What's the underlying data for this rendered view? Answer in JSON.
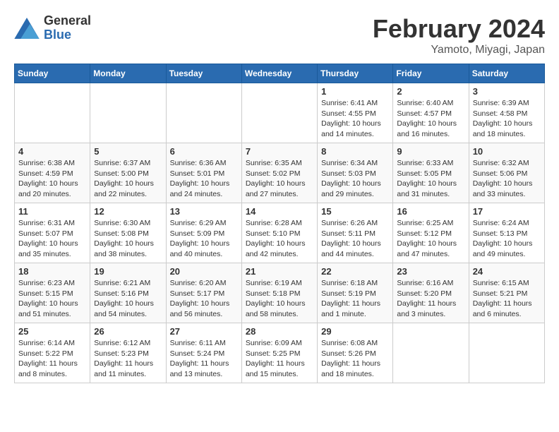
{
  "logo": {
    "general": "General",
    "blue": "Blue"
  },
  "title": "February 2024",
  "subtitle": "Yamoto, Miyagi, Japan",
  "days_of_week": [
    "Sunday",
    "Monday",
    "Tuesday",
    "Wednesday",
    "Thursday",
    "Friday",
    "Saturday"
  ],
  "weeks": [
    [
      {
        "day": "",
        "info": ""
      },
      {
        "day": "",
        "info": ""
      },
      {
        "day": "",
        "info": ""
      },
      {
        "day": "",
        "info": ""
      },
      {
        "day": "1",
        "info": "Sunrise: 6:41 AM\nSunset: 4:55 PM\nDaylight: 10 hours\nand 14 minutes."
      },
      {
        "day": "2",
        "info": "Sunrise: 6:40 AM\nSunset: 4:57 PM\nDaylight: 10 hours\nand 16 minutes."
      },
      {
        "day": "3",
        "info": "Sunrise: 6:39 AM\nSunset: 4:58 PM\nDaylight: 10 hours\nand 18 minutes."
      }
    ],
    [
      {
        "day": "4",
        "info": "Sunrise: 6:38 AM\nSunset: 4:59 PM\nDaylight: 10 hours\nand 20 minutes."
      },
      {
        "day": "5",
        "info": "Sunrise: 6:37 AM\nSunset: 5:00 PM\nDaylight: 10 hours\nand 22 minutes."
      },
      {
        "day": "6",
        "info": "Sunrise: 6:36 AM\nSunset: 5:01 PM\nDaylight: 10 hours\nand 24 minutes."
      },
      {
        "day": "7",
        "info": "Sunrise: 6:35 AM\nSunset: 5:02 PM\nDaylight: 10 hours\nand 27 minutes."
      },
      {
        "day": "8",
        "info": "Sunrise: 6:34 AM\nSunset: 5:03 PM\nDaylight: 10 hours\nand 29 minutes."
      },
      {
        "day": "9",
        "info": "Sunrise: 6:33 AM\nSunset: 5:05 PM\nDaylight: 10 hours\nand 31 minutes."
      },
      {
        "day": "10",
        "info": "Sunrise: 6:32 AM\nSunset: 5:06 PM\nDaylight: 10 hours\nand 33 minutes."
      }
    ],
    [
      {
        "day": "11",
        "info": "Sunrise: 6:31 AM\nSunset: 5:07 PM\nDaylight: 10 hours\nand 35 minutes."
      },
      {
        "day": "12",
        "info": "Sunrise: 6:30 AM\nSunset: 5:08 PM\nDaylight: 10 hours\nand 38 minutes."
      },
      {
        "day": "13",
        "info": "Sunrise: 6:29 AM\nSunset: 5:09 PM\nDaylight: 10 hours\nand 40 minutes."
      },
      {
        "day": "14",
        "info": "Sunrise: 6:28 AM\nSunset: 5:10 PM\nDaylight: 10 hours\nand 42 minutes."
      },
      {
        "day": "15",
        "info": "Sunrise: 6:26 AM\nSunset: 5:11 PM\nDaylight: 10 hours\nand 44 minutes."
      },
      {
        "day": "16",
        "info": "Sunrise: 6:25 AM\nSunset: 5:12 PM\nDaylight: 10 hours\nand 47 minutes."
      },
      {
        "day": "17",
        "info": "Sunrise: 6:24 AM\nSunset: 5:13 PM\nDaylight: 10 hours\nand 49 minutes."
      }
    ],
    [
      {
        "day": "18",
        "info": "Sunrise: 6:23 AM\nSunset: 5:15 PM\nDaylight: 10 hours\nand 51 minutes."
      },
      {
        "day": "19",
        "info": "Sunrise: 6:21 AM\nSunset: 5:16 PM\nDaylight: 10 hours\nand 54 minutes."
      },
      {
        "day": "20",
        "info": "Sunrise: 6:20 AM\nSunset: 5:17 PM\nDaylight: 10 hours\nand 56 minutes."
      },
      {
        "day": "21",
        "info": "Sunrise: 6:19 AM\nSunset: 5:18 PM\nDaylight: 10 hours\nand 58 minutes."
      },
      {
        "day": "22",
        "info": "Sunrise: 6:18 AM\nSunset: 5:19 PM\nDaylight: 11 hours\nand 1 minute."
      },
      {
        "day": "23",
        "info": "Sunrise: 6:16 AM\nSunset: 5:20 PM\nDaylight: 11 hours\nand 3 minutes."
      },
      {
        "day": "24",
        "info": "Sunrise: 6:15 AM\nSunset: 5:21 PM\nDaylight: 11 hours\nand 6 minutes."
      }
    ],
    [
      {
        "day": "25",
        "info": "Sunrise: 6:14 AM\nSunset: 5:22 PM\nDaylight: 11 hours\nand 8 minutes."
      },
      {
        "day": "26",
        "info": "Sunrise: 6:12 AM\nSunset: 5:23 PM\nDaylight: 11 hours\nand 11 minutes."
      },
      {
        "day": "27",
        "info": "Sunrise: 6:11 AM\nSunset: 5:24 PM\nDaylight: 11 hours\nand 13 minutes."
      },
      {
        "day": "28",
        "info": "Sunrise: 6:09 AM\nSunset: 5:25 PM\nDaylight: 11 hours\nand 15 minutes."
      },
      {
        "day": "29",
        "info": "Sunrise: 6:08 AM\nSunset: 5:26 PM\nDaylight: 11 hours\nand 18 minutes."
      },
      {
        "day": "",
        "info": ""
      },
      {
        "day": "",
        "info": ""
      }
    ]
  ]
}
